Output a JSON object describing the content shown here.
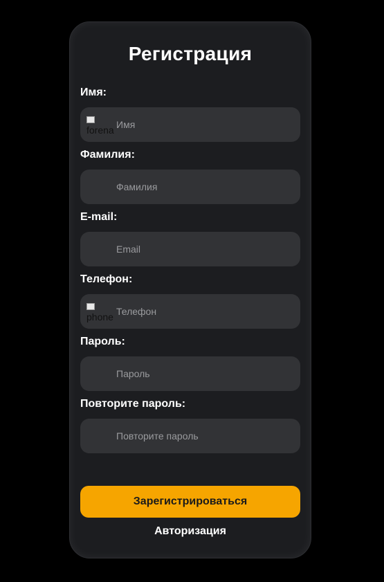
{
  "form": {
    "title": "Регистрация",
    "fields": [
      {
        "label": "Имя:",
        "placeholder": "Имя",
        "icon": "forename-icon",
        "icon_alt": "forena"
      },
      {
        "label": "Фамилия:",
        "placeholder": "Фамилия",
        "icon": "surname-icon"
      },
      {
        "label": "E-mail:",
        "placeholder": "Email",
        "icon": "email-icon"
      },
      {
        "label": "Телефон:",
        "placeholder": "Телефон",
        "icon": "phone-icon",
        "icon_alt": "phone"
      },
      {
        "label": "Пароль:",
        "placeholder": "Пароль",
        "icon": "password-icon"
      },
      {
        "label": "Повторите пароль:",
        "placeholder": "Повторите пароль",
        "icon": "password-repeat-icon"
      }
    ],
    "submit_label": "Зарегистрироваться",
    "auth_link_label": "Авторизация"
  },
  "colors": {
    "page_bg": "#000000",
    "card_bg": "#1c1d20",
    "input_bg": "#323336",
    "accent": "#f6a500",
    "text": "#ffffff",
    "placeholder": "#9a9b9e"
  }
}
